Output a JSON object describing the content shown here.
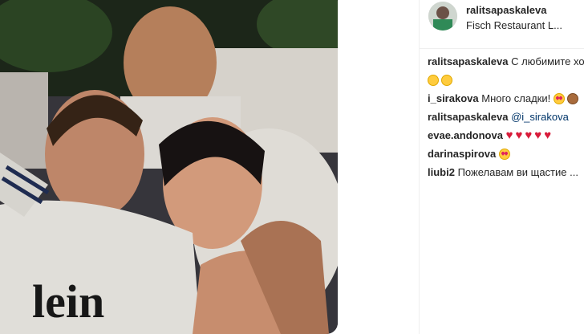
{
  "header": {
    "username": "ralitsapaskaleva",
    "location": "Fisch Restaurant L..."
  },
  "comments": [
    {
      "user": "ralitsapaskaleva",
      "text": "С любимите хо",
      "emoji": []
    },
    {
      "user": "",
      "text": "",
      "emoji": [
        "smiling-face",
        "kissing-face"
      ]
    },
    {
      "user": "i_sirakova",
      "text": "Много сладки!",
      "emoji": [
        "heart-eyes-face",
        "see-no-evil-monkey"
      ]
    },
    {
      "user": "ralitsapaskaleva",
      "text": "@i_sirakova",
      "emoji": []
    },
    {
      "user": "evae.andonova",
      "text": "",
      "emoji": [
        "sparkling-heart",
        "sparkling-heart",
        "sparkling-heart",
        "sparkling-heart",
        "sparkling-heart"
      ]
    },
    {
      "user": "darinaspirova",
      "text": "",
      "emoji": [
        "heart-eyes-face"
      ]
    },
    {
      "user": "liubi2",
      "text": "Пожелавам ви щастие ...",
      "emoji": []
    }
  ],
  "colors": {
    "text": "#262626",
    "mention": "#003569",
    "divider": "#efefef",
    "heart": "#d81b3a"
  }
}
